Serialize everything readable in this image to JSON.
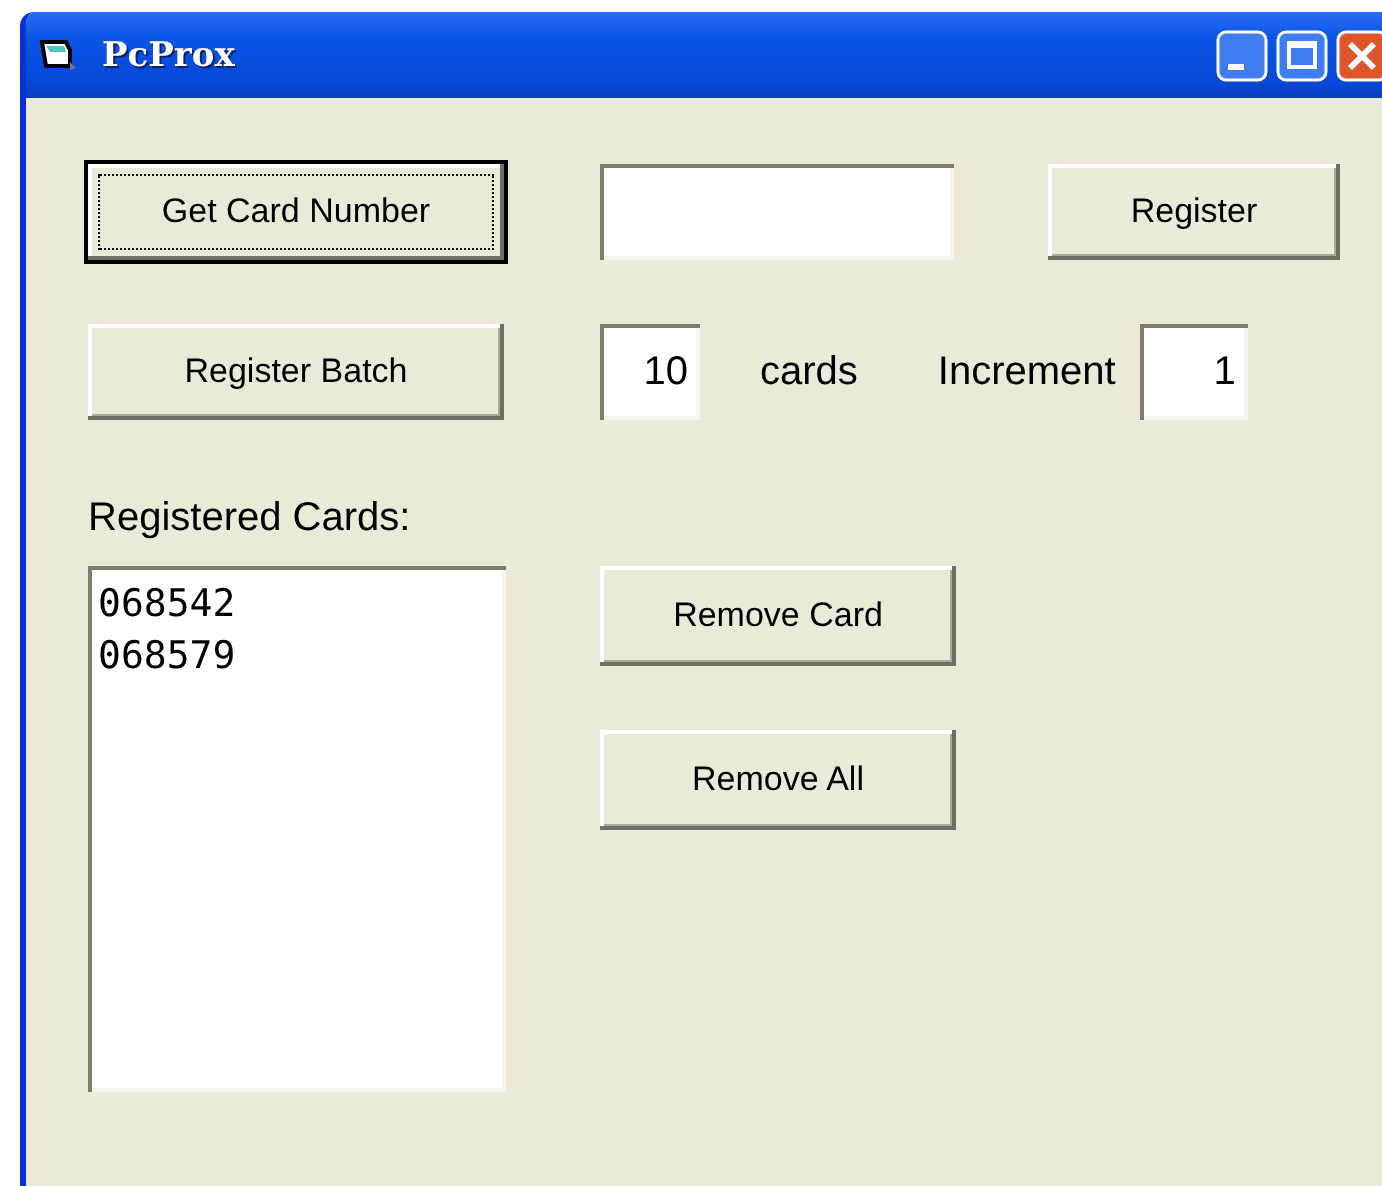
{
  "window": {
    "title": "PcProx"
  },
  "get_card_button": {
    "label": "Get Card Number",
    "focused": true
  },
  "register_button": {
    "label": "Register",
    "focused": false
  },
  "register_batch_button": {
    "label": "Register Batch",
    "focused": false
  },
  "count_field": {
    "value": "10"
  },
  "cards_label": "cards",
  "increment_label": "Increment",
  "increment_field": {
    "value": "1"
  },
  "registered_label": "Registered Cards:",
  "registered_cards": [
    "068542",
    "068579"
  ],
  "remove_card_button": {
    "label": "Remove Card",
    "focused": false
  },
  "remove_all_button": {
    "label": "Remove All",
    "focused": false
  }
}
